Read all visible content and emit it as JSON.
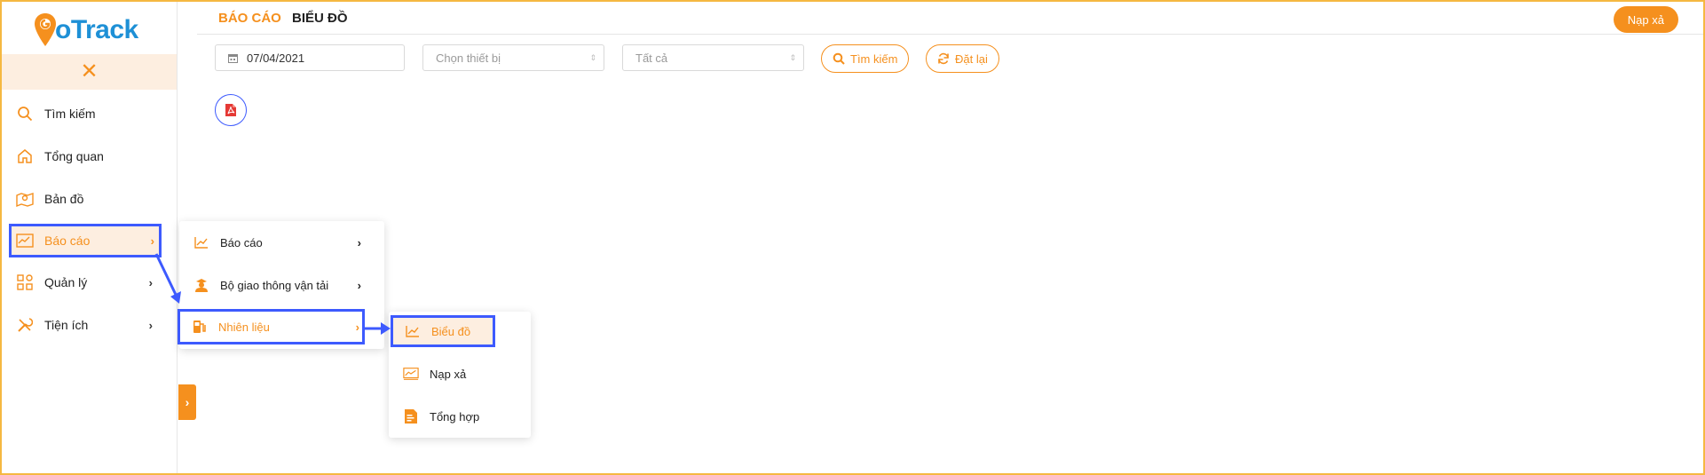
{
  "brand": {
    "logo_text_g": "G",
    "logo_text_o": "o",
    "logo_text_rest": "Track"
  },
  "sidebar": {
    "items": [
      {
        "label": "Tìm kiếm",
        "icon": "search-icon"
      },
      {
        "label": "Tổng quan",
        "icon": "home-icon"
      },
      {
        "label": "Bản đồ",
        "icon": "map-icon"
      },
      {
        "label": "Báo cáo",
        "icon": "chart-icon",
        "chevron": "›"
      },
      {
        "label": "Quản lý",
        "icon": "grid-icon",
        "chevron": "›"
      },
      {
        "label": "Tiện ích",
        "icon": "tools-icon",
        "chevron": "›"
      }
    ],
    "close_glyph": "✕",
    "expand_glyph": "›"
  },
  "header": {
    "breadcrumb_section": "BÁO CÁO",
    "breadcrumb_page": "BIỂU ĐỒ",
    "action_button": "Nạp xả"
  },
  "filters": {
    "date_value": "07/04/2021",
    "device_placeholder": "Chọn thiết bị",
    "scope_placeholder": "Tất cả",
    "search_button": "Tìm kiếm",
    "reset_button": "Đặt lại"
  },
  "submenu_level1": [
    {
      "label": "Báo cáo",
      "icon": "line-chart-icon",
      "chevron": "›"
    },
    {
      "label": "Bộ giao thông vận tải",
      "icon": "officer-icon",
      "chevron": "›"
    },
    {
      "label": "Nhiên liệu",
      "icon": "fuel-icon",
      "chevron": "›"
    }
  ],
  "submenu_level2": [
    {
      "label": "Biểu đồ",
      "icon": "line-chart-icon"
    },
    {
      "label": "Nạp xả",
      "icon": "monitor-chart-icon"
    },
    {
      "label": "Tổng hợp",
      "icon": "summary-doc-icon"
    }
  ],
  "colors": {
    "accent": "#f5901e",
    "highlight": "#3d5afe",
    "frame": "#f5b841",
    "active_bg": "#fdeee0"
  }
}
